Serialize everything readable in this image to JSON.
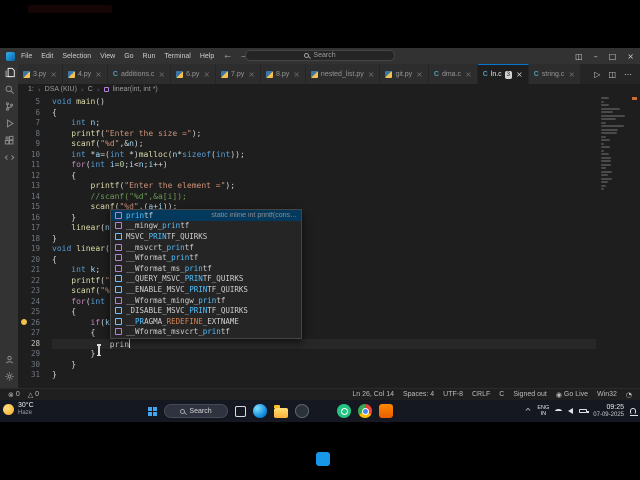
{
  "glyphs": {
    "run": "▷",
    "split": "◫",
    "more": "⋯",
    "min": "–",
    "max": "□",
    "close": "×",
    "back": "←",
    "fwd": "→",
    "sep": "›",
    "caret": "^",
    "close_tab": "×",
    "error": "⊗",
    "warning": "△",
    "broadcast": "◉",
    "bell": "◔"
  },
  "titlebar": {
    "menus": [
      "File",
      "Edit",
      "Selection",
      "View",
      "Go",
      "Run",
      "Terminal",
      "Help"
    ],
    "search": "Search"
  },
  "tabs": [
    {
      "label": "3.py",
      "lang": "py"
    },
    {
      "label": "4.py",
      "lang": "py"
    },
    {
      "label": "additions.c",
      "lang": "c"
    },
    {
      "label": "6.py",
      "lang": "py"
    },
    {
      "label": "7.py",
      "lang": "py"
    },
    {
      "label": "8.py",
      "lang": "py"
    },
    {
      "label": "nested_list.py",
      "lang": "py"
    },
    {
      "label": "git.py",
      "lang": "py"
    },
    {
      "label": "dma.c",
      "lang": "c"
    },
    {
      "label": "ln.c",
      "lang": "c",
      "active": true,
      "badge": "3"
    },
    {
      "label": "string.c",
      "lang": "c"
    }
  ],
  "breadcrumb": {
    "crumbs": [
      "1:",
      "DSA (KIU)",
      "C",
      "linear(int, int *)"
    ]
  },
  "activitybar": {
    "top": [
      "explorer",
      "search",
      "source-control",
      "run-debug",
      "extensions",
      "remote"
    ],
    "bottom": [
      "account",
      "settings"
    ]
  },
  "editor": {
    "lines": [
      {
        "n": 5,
        "t": [
          [
            "k",
            "void"
          ],
          [
            "t",
            " "
          ],
          [
            "f",
            "main"
          ],
          [
            "t",
            "()"
          ]
        ]
      },
      {
        "n": 6,
        "t": [
          [
            "t",
            "{"
          ]
        ]
      },
      {
        "n": 7,
        "t": [
          [
            "t",
            "    "
          ],
          [
            "k",
            "int"
          ],
          [
            "t",
            " "
          ],
          [
            "v",
            "n"
          ],
          [
            "t",
            ";"
          ]
        ]
      },
      {
        "n": 8,
        "t": [
          [
            "t",
            "    "
          ],
          [
            "f",
            "printf"
          ],
          [
            "t",
            "("
          ],
          [
            "s",
            "\"Enter the size =\""
          ],
          [
            "t",
            ");"
          ]
        ]
      },
      {
        "n": 9,
        "t": [
          [
            "t",
            "    "
          ],
          [
            "f",
            "scanf"
          ],
          [
            "t",
            "("
          ],
          [
            "s",
            "\"%d\""
          ],
          [
            "t",
            ",&"
          ],
          [
            "v",
            "n"
          ],
          [
            "t",
            ");"
          ]
        ]
      },
      {
        "n": 10,
        "t": [
          [
            "t",
            "    "
          ],
          [
            "k",
            "int"
          ],
          [
            "t",
            " *"
          ],
          [
            "v",
            "a"
          ],
          [
            "t",
            "=("
          ],
          [
            "k",
            "int"
          ],
          [
            "t",
            " *)"
          ],
          [
            "f",
            "malloc"
          ],
          [
            "t",
            "("
          ],
          [
            "v",
            "n"
          ],
          [
            "t",
            "*"
          ],
          [
            "k",
            "sizeof"
          ],
          [
            "t",
            "("
          ],
          [
            "k",
            "int"
          ],
          [
            "t",
            "));"
          ]
        ]
      },
      {
        "n": 11,
        "t": [
          [
            "t",
            "    "
          ],
          [
            "c",
            "for"
          ],
          [
            "t",
            "("
          ],
          [
            "k",
            "int"
          ],
          [
            "t",
            " "
          ],
          [
            "v",
            "i"
          ],
          [
            "t",
            "="
          ],
          [
            "d",
            "0"
          ],
          [
            "t",
            ";"
          ],
          [
            "v",
            "i"
          ],
          [
            "t",
            "<"
          ],
          [
            "v",
            "n"
          ],
          [
            "t",
            ";"
          ],
          [
            "v",
            "i"
          ],
          [
            "t",
            "++)"
          ]
        ]
      },
      {
        "n": 12,
        "t": [
          [
            "t",
            "    {"
          ]
        ]
      },
      {
        "n": 13,
        "t": [
          [
            "t",
            "        "
          ],
          [
            "f",
            "printf"
          ],
          [
            "t",
            "("
          ],
          [
            "s",
            "\"Enter the element =\""
          ],
          [
            "t",
            ");"
          ]
        ]
      },
      {
        "n": 14,
        "t": [
          [
            "t",
            "        "
          ],
          [
            "m",
            "//scanf(\"%d\",&a[i]);"
          ]
        ]
      },
      {
        "n": 15,
        "t": [
          [
            "t",
            "        "
          ],
          [
            "f",
            "scanf"
          ],
          [
            "t",
            "("
          ],
          [
            "s",
            "\"%d\""
          ],
          [
            "t",
            ",("
          ],
          [
            "v",
            "a"
          ],
          [
            "t",
            "+"
          ],
          [
            "v",
            "i"
          ],
          [
            "t",
            "));"
          ]
        ]
      },
      {
        "n": 16,
        "t": [
          [
            "t",
            "    }"
          ]
        ]
      },
      {
        "n": 17,
        "t": [
          [
            "t",
            "    "
          ],
          [
            "f",
            "linear"
          ],
          [
            "t",
            "("
          ],
          [
            "v",
            "n"
          ],
          [
            "t",
            ","
          ]
        ]
      },
      {
        "n": 18,
        "t": [
          [
            "t",
            "}"
          ]
        ]
      },
      {
        "n": 19,
        "t": [
          [
            "k",
            "void"
          ],
          [
            "t",
            " "
          ],
          [
            "f",
            "linear"
          ],
          [
            "t",
            "("
          ],
          [
            "k",
            "i"
          ]
        ]
      },
      {
        "n": 20,
        "t": [
          [
            "t",
            "{"
          ]
        ]
      },
      {
        "n": 21,
        "t": [
          [
            "t",
            "    "
          ],
          [
            "k",
            "int"
          ],
          [
            "t",
            " "
          ],
          [
            "v",
            "k"
          ],
          [
            "t",
            ";"
          ]
        ]
      },
      {
        "n": 22,
        "t": [
          [
            "t",
            "    "
          ],
          [
            "f",
            "printf"
          ],
          [
            "t",
            "("
          ],
          [
            "s",
            "\"En"
          ]
        ]
      },
      {
        "n": 23,
        "t": [
          [
            "t",
            "    "
          ],
          [
            "f",
            "scanf"
          ],
          [
            "t",
            "("
          ],
          [
            "s",
            "\"%d\""
          ]
        ]
      },
      {
        "n": 24,
        "t": [
          [
            "t",
            "    "
          ],
          [
            "c",
            "for"
          ],
          [
            "t",
            "("
          ],
          [
            "k",
            "int"
          ],
          [
            "t",
            " "
          ],
          [
            "v",
            "i"
          ],
          [
            "t",
            "="
          ]
        ]
      },
      {
        "n": 25,
        "t": [
          [
            "t",
            "    {"
          ]
        ]
      },
      {
        "n": 26,
        "t": [
          [
            "t",
            "        "
          ],
          [
            "c",
            "if"
          ],
          [
            "t",
            "("
          ],
          [
            "v",
            "k"
          ],
          [
            "t",
            "== *"
          ]
        ]
      },
      {
        "n": 27,
        "t": [
          [
            "t",
            "        {"
          ]
        ]
      },
      {
        "n": 28,
        "t": [
          [
            "t",
            "            "
          ],
          [
            "t",
            "prin"
          ]
        ],
        "cursor": true
      },
      {
        "n": 29,
        "t": [
          [
            "t",
            "        }"
          ]
        ]
      },
      {
        "n": 30,
        "t": [
          [
            "t",
            "    }"
          ]
        ]
      },
      {
        "n": 31,
        "t": [
          [
            "t",
            "}"
          ]
        ]
      }
    ]
  },
  "suggest": {
    "items": [
      {
        "kind": "fn",
        "selected": true,
        "detail": "static inline int printf(cons…",
        "segs": [
          [
            "hl",
            "prin"
          ],
          [
            "",
            "tf"
          ]
        ]
      },
      {
        "kind": "fn",
        "segs": [
          [
            "",
            "__mingw_"
          ],
          [
            "hl",
            "prin"
          ],
          [
            "",
            "tf"
          ]
        ]
      },
      {
        "kind": "const",
        "segs": [
          [
            "",
            "MSVC_"
          ],
          [
            "hl",
            "PRIN"
          ],
          [
            "",
            "TF_QUIRKS"
          ]
        ]
      },
      {
        "kind": "fn",
        "segs": [
          [
            "",
            "__msvcrt_"
          ],
          [
            "hl",
            "prin"
          ],
          [
            "",
            "tf"
          ]
        ]
      },
      {
        "kind": "fn",
        "segs": [
          [
            "",
            "__Wformat_"
          ],
          [
            "hl",
            "prin"
          ],
          [
            "",
            "tf"
          ]
        ]
      },
      {
        "kind": "fn",
        "segs": [
          [
            "",
            "__Wformat_ms_"
          ],
          [
            "hl",
            "prin"
          ],
          [
            "",
            "tf"
          ]
        ]
      },
      {
        "kind": "const",
        "segs": [
          [
            "",
            "__QUERY_MSVC_"
          ],
          [
            "hl",
            "PRIN"
          ],
          [
            "",
            "TF_QUIRKS"
          ]
        ]
      },
      {
        "kind": "const",
        "segs": [
          [
            "",
            "__ENABLE_MSVC_"
          ],
          [
            "hl",
            "PRIN"
          ],
          [
            "",
            "TF_QUIRKS"
          ]
        ]
      },
      {
        "kind": "fn",
        "segs": [
          [
            "",
            "__Wformat_mingw_"
          ],
          [
            "hl",
            "prin"
          ],
          [
            "",
            "tf"
          ]
        ]
      },
      {
        "kind": "const",
        "segs": [
          [
            "",
            "_DISABLE_MSVC_"
          ],
          [
            "hl",
            "PRIN"
          ],
          [
            "",
            "TF_QUIRKS"
          ]
        ]
      },
      {
        "kind": "const",
        "segs": [
          [
            "",
            "__"
          ],
          [
            "hl",
            "PR"
          ],
          [
            "",
            "AGMA_"
          ],
          [
            "ho",
            "REDEFINE"
          ],
          [
            "",
            "_EXTNAME"
          ]
        ]
      },
      {
        "kind": "fn",
        "segs": [
          [
            "",
            "__Wformat_msvcrt_"
          ],
          [
            "hl",
            "prin"
          ],
          [
            "",
            "tf"
          ]
        ]
      }
    ]
  },
  "statusbar": {
    "left": [
      {
        "icon": "error",
        "label": "0"
      },
      {
        "icon": "warning",
        "label": "0"
      }
    ],
    "right": [
      {
        "label": "Ln 26, Col 14"
      },
      {
        "label": "Spaces: 4"
      },
      {
        "label": "UTF-8"
      },
      {
        "label": "CRLF"
      },
      {
        "label": "C"
      },
      {
        "label": "Signed out"
      },
      {
        "icon": "broadcast",
        "label": "Go Live"
      },
      {
        "label": "Win32"
      },
      {
        "icon": "bell",
        "label": ""
      }
    ]
  },
  "taskbar": {
    "weather": {
      "temp": "30°C",
      "cond": "Haze"
    },
    "search": "Search",
    "apps": [
      "task-view",
      "edge",
      "file-explorer",
      "obs",
      "vscode",
      "whatsapp",
      "chrome",
      "vlc"
    ],
    "tray": {
      "lang_top": "ENG",
      "lang_bottom": "IN",
      "time": "09:25",
      "date": "07-09-2025"
    }
  }
}
